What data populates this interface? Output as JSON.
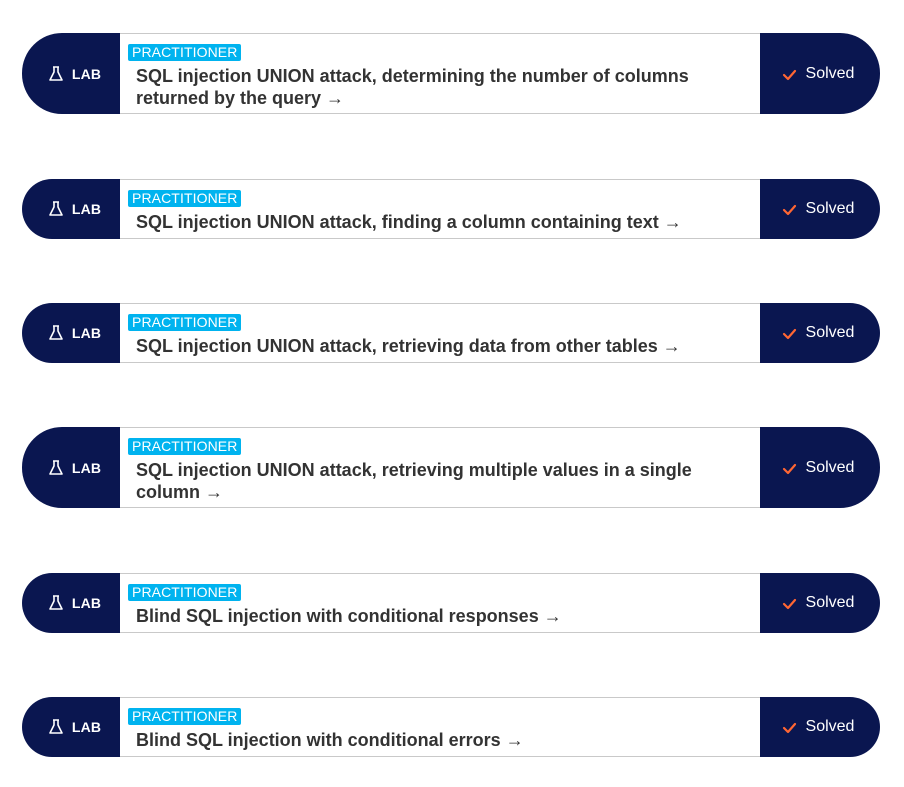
{
  "labs": [
    {
      "badge": "LAB",
      "badge_icon": "flask-icon",
      "level": "PRACTITIONER",
      "title": "SQL injection UNION attack, determining the number of columns returned by the query →",
      "status": "Solved",
      "status_icon": "check-icon"
    },
    {
      "badge": "LAB",
      "badge_icon": "flask-icon",
      "level": "PRACTITIONER",
      "title": "SQL injection UNION attack, finding a column containing text →",
      "status": "Solved",
      "status_icon": "check-icon"
    },
    {
      "badge": "LAB",
      "badge_icon": "flask-icon",
      "level": "PRACTITIONER",
      "title": "SQL injection UNION attack, retrieving data from other tables →",
      "status": "Solved",
      "status_icon": "check-icon"
    },
    {
      "badge": "LAB",
      "badge_icon": "flask-icon",
      "level": "PRACTITIONER",
      "title": "SQL injection UNION attack, retrieving multiple values in a single column →",
      "status": "Solved",
      "status_icon": "check-icon"
    },
    {
      "badge": "LAB",
      "badge_icon": "flask-icon",
      "level": "PRACTITIONER",
      "title": "Blind SQL injection with conditional responses →",
      "status": "Solved",
      "status_icon": "check-icon"
    },
    {
      "badge": "LAB",
      "badge_icon": "flask-icon",
      "level": "PRACTITIONER",
      "title": "Blind SQL injection with conditional errors →",
      "status": "Solved",
      "status_icon": "check-icon"
    }
  ],
  "colors": {
    "navy": "#0a1650",
    "tag_blue": "#00b3ef",
    "check_orange": "#ff6633",
    "title_text": "#333333"
  }
}
